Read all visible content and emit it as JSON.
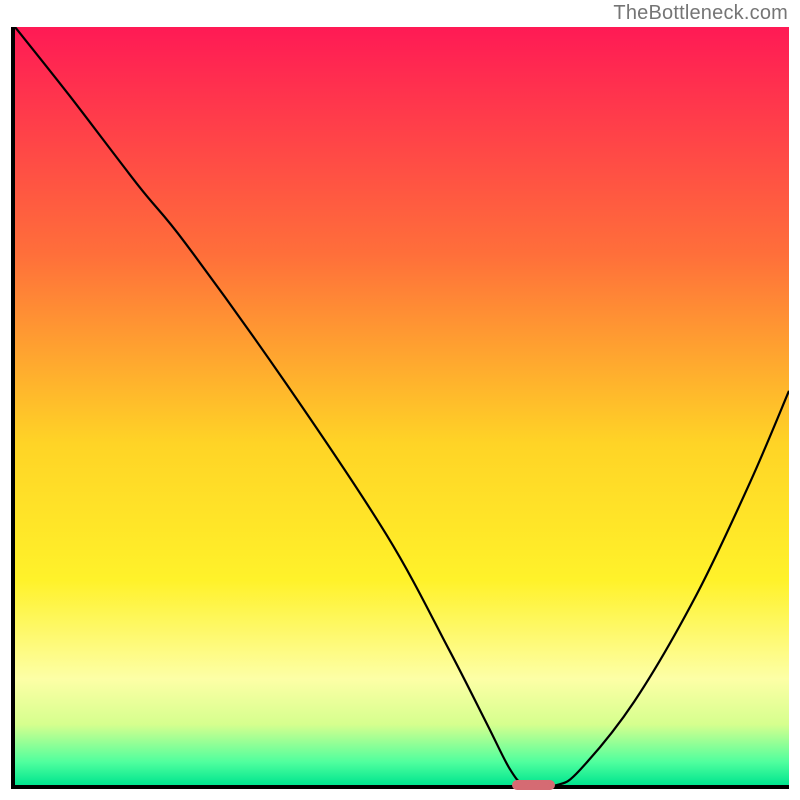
{
  "watermark": "TheBottleneck.com",
  "chart_data": {
    "type": "line",
    "title": "",
    "xlabel": "",
    "ylabel": "",
    "xlim": [
      0,
      100
    ],
    "ylim": [
      0,
      100
    ],
    "gradient_stops": [
      {
        "pos": 0,
        "color": "#ff1a55"
      },
      {
        "pos": 30,
        "color": "#ff6f3a"
      },
      {
        "pos": 55,
        "color": "#ffd426"
      },
      {
        "pos": 73,
        "color": "#fff22a"
      },
      {
        "pos": 86,
        "color": "#fdffa6"
      },
      {
        "pos": 92,
        "color": "#d6ff8e"
      },
      {
        "pos": 97,
        "color": "#4fff9e"
      },
      {
        "pos": 100,
        "color": "#00e58f"
      }
    ],
    "series": [
      {
        "name": "bottleneck-curve",
        "points": [
          {
            "x": 0,
            "y": 100
          },
          {
            "x": 7,
            "y": 91
          },
          {
            "x": 16,
            "y": 79
          },
          {
            "x": 22,
            "y": 71.5
          },
          {
            "x": 35,
            "y": 53
          },
          {
            "x": 48,
            "y": 33
          },
          {
            "x": 56,
            "y": 18
          },
          {
            "x": 61,
            "y": 8
          },
          {
            "x": 64,
            "y": 2
          },
          {
            "x": 66,
            "y": 0
          },
          {
            "x": 70,
            "y": 0
          },
          {
            "x": 73,
            "y": 2
          },
          {
            "x": 80,
            "y": 11
          },
          {
            "x": 88,
            "y": 25
          },
          {
            "x": 95,
            "y": 40
          },
          {
            "x": 100,
            "y": 52
          }
        ]
      }
    ],
    "marker": {
      "x": 67,
      "y": 0,
      "w": 5.5,
      "h": 1.2
    }
  }
}
